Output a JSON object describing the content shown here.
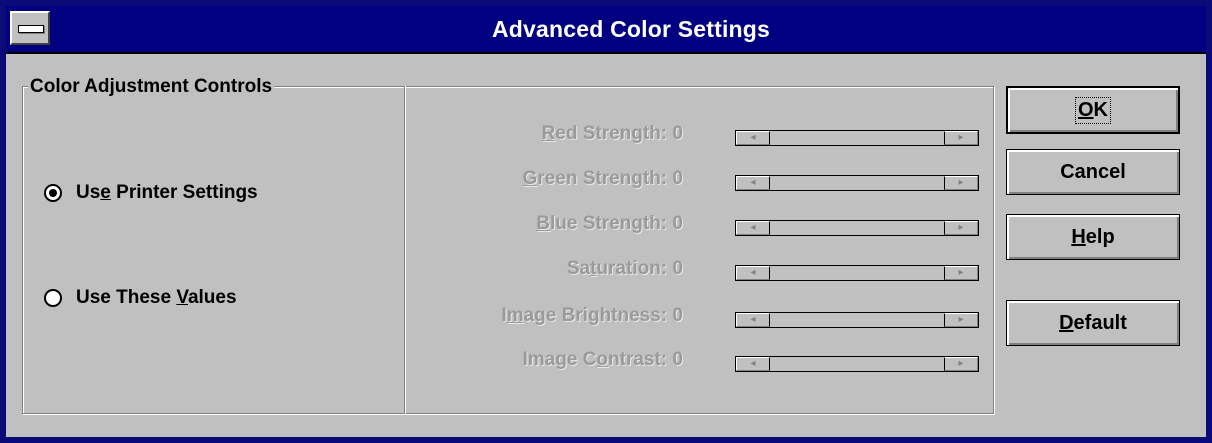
{
  "window": {
    "title": "Advanced Color Settings"
  },
  "group": {
    "title": "Color Adjustment Controls"
  },
  "radios": [
    {
      "pre": "Us",
      "accel": "e",
      "post": " Printer Settings",
      "checked": true
    },
    {
      "pre": "Use These ",
      "accel": "V",
      "post": "alues",
      "checked": false
    }
  ],
  "sliders": [
    {
      "pre": "",
      "accel": "R",
      "post": "ed Strength:",
      "value": "0"
    },
    {
      "pre": "",
      "accel": "G",
      "post": "reen Strength:",
      "value": "0"
    },
    {
      "pre": "",
      "accel": "B",
      "post": "lue Strength:",
      "value": "0"
    },
    {
      "pre": "Sa",
      "accel": "t",
      "post": "uration:",
      "value": "0"
    },
    {
      "pre": "I",
      "accel": "m",
      "post": "age Brightness:",
      "value": "0"
    },
    {
      "pre": "Image C",
      "accel": "o",
      "post": "ntrast:",
      "value": "0"
    }
  ],
  "buttons": {
    "ok": {
      "pre": "",
      "accel": "O",
      "post": "K"
    },
    "cancel": "Cancel",
    "help": {
      "pre": "",
      "accel": "H",
      "post": "elp"
    },
    "default": {
      "pre": "",
      "accel": "D",
      "post": "efault"
    }
  },
  "icons": {
    "scroll_left": "◂",
    "scroll_right": "▸"
  },
  "colors": {
    "titlebar": "#000080",
    "face": "#c0c0c0",
    "disabled_text": "#9a9a9a"
  }
}
